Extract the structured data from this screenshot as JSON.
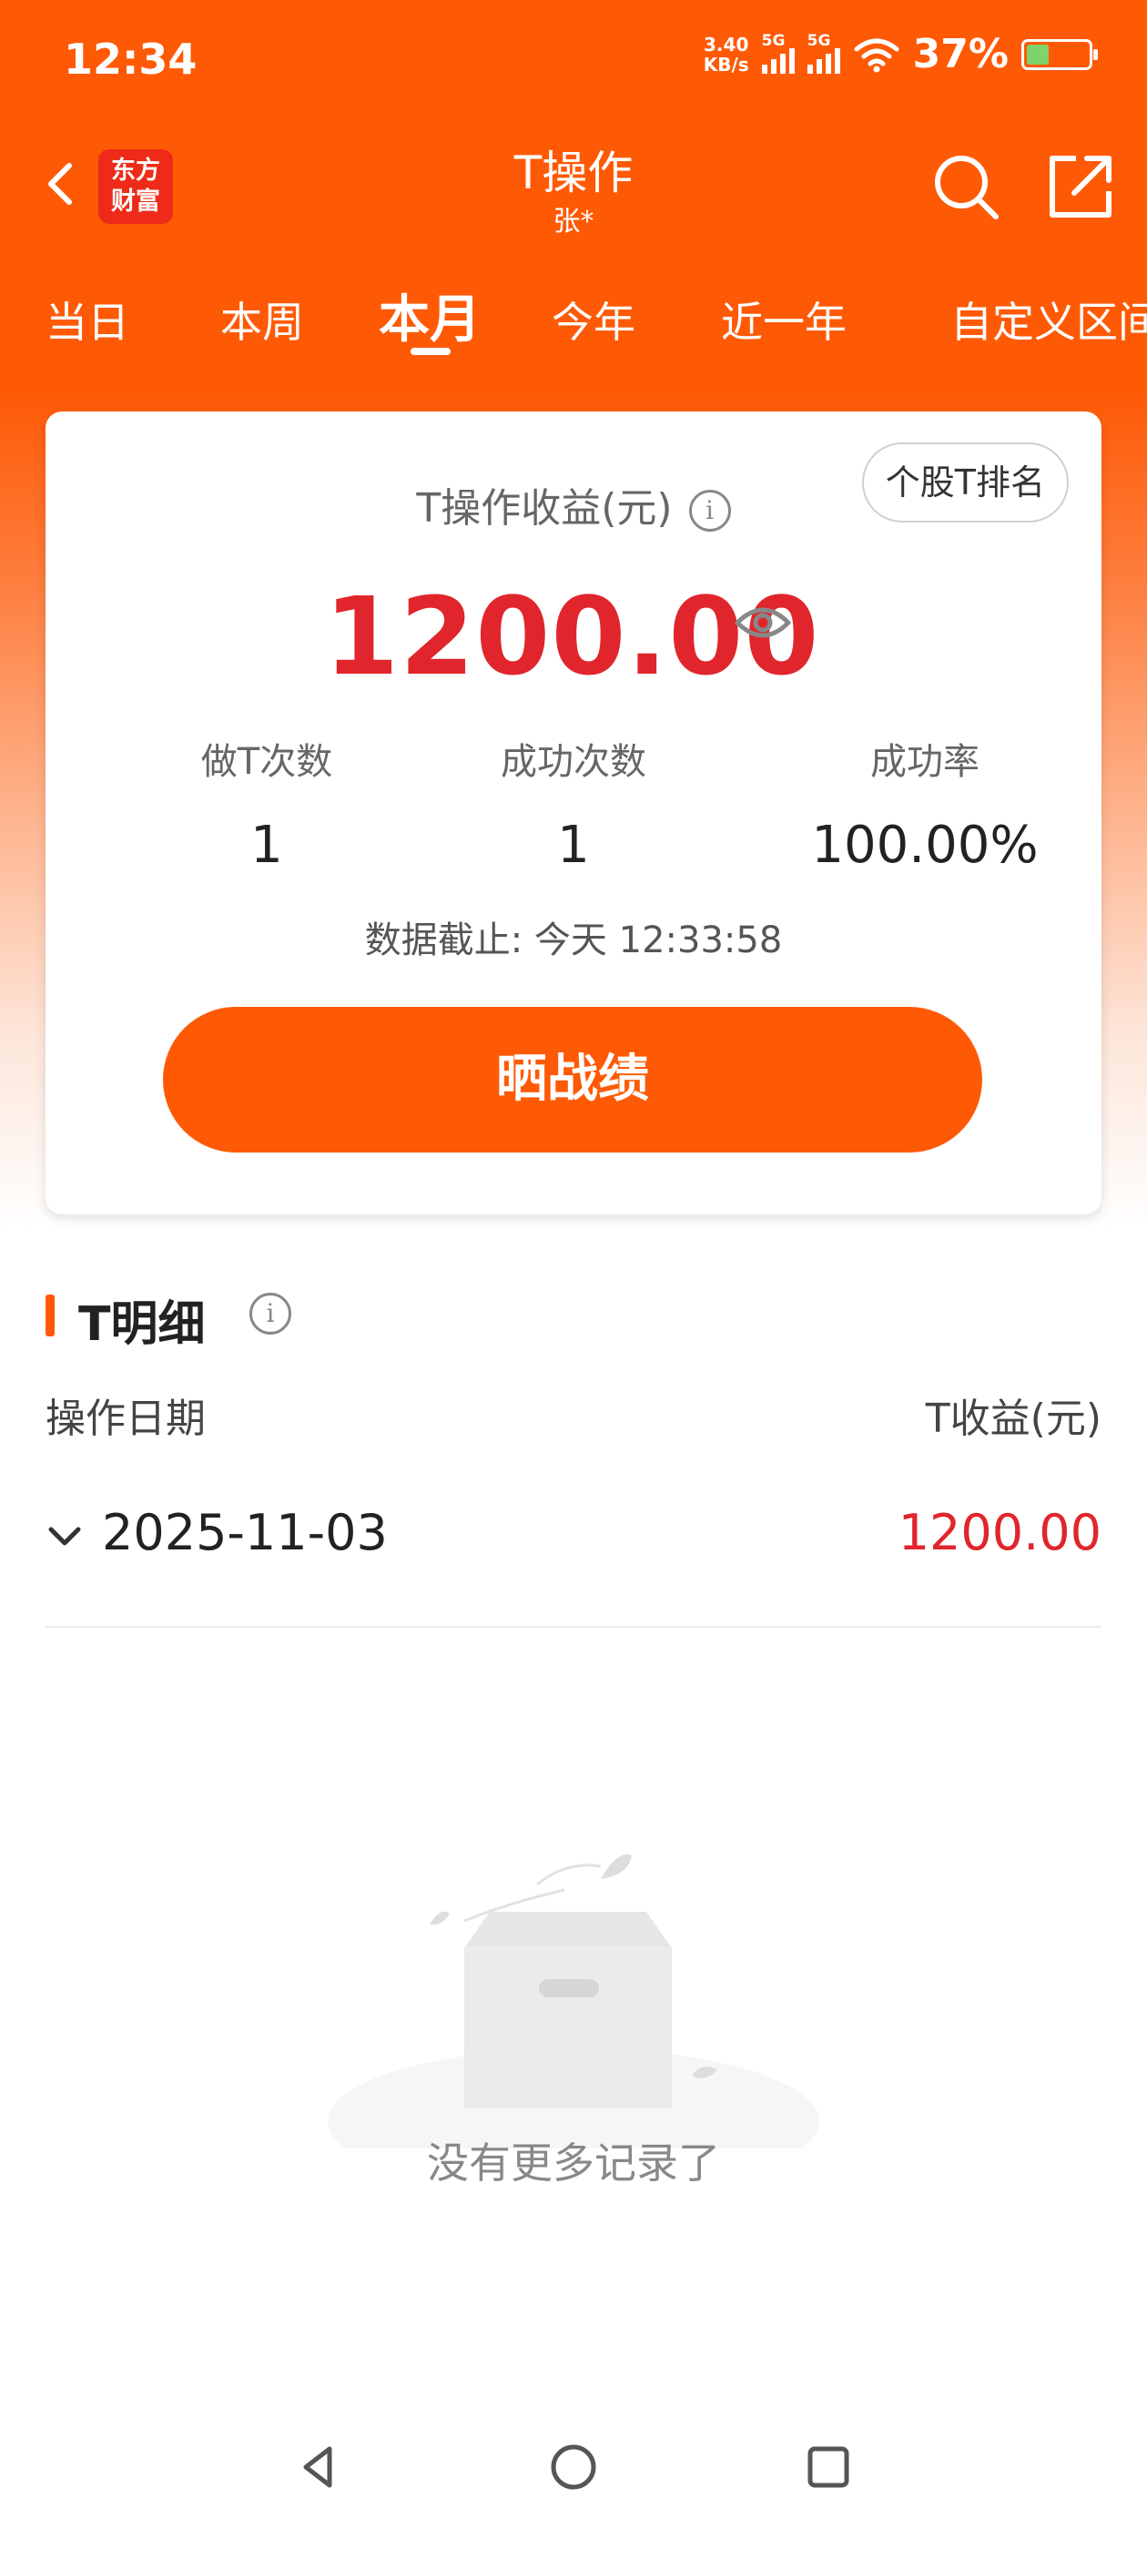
{
  "status_bar": {
    "time": "12:34",
    "net_speed_value": "3.40",
    "net_speed_unit": "KB/s",
    "sim1": "5G",
    "sim2": "5G",
    "battery_pct": "37%",
    "battery_level": 0.37
  },
  "header": {
    "logo_line1": "东方",
    "logo_line2": "财富",
    "title": "T操作",
    "subtitle": "张*"
  },
  "tabs": [
    {
      "label": "当日",
      "active": false
    },
    {
      "label": "本周",
      "active": false
    },
    {
      "label": "本月",
      "active": true
    },
    {
      "label": "今年",
      "active": false
    },
    {
      "label": "近一年",
      "active": false
    },
    {
      "label": "自定义区间",
      "active": false
    }
  ],
  "summary": {
    "rank_button": "个股T排名",
    "label": "T操作收益(元)",
    "info_glyph": "i",
    "amount": "1200.00",
    "stats": [
      {
        "label": "做T次数",
        "value": "1"
      },
      {
        "label": "成功次数",
        "value": "1"
      },
      {
        "label": "成功率",
        "value": "100.00%"
      }
    ],
    "cutoff": "数据截止: 今天 12:33:58",
    "share_button": "晒战绩"
  },
  "detail": {
    "title": "T明细",
    "col_date": "操作日期",
    "col_profit": "T收益(元)",
    "rows": [
      {
        "date": "2025-11-03",
        "profit": "1200.00"
      }
    ],
    "empty_text": "没有更多记录了"
  },
  "colors": {
    "brand": "#fe5a06",
    "profit_red": "#e0262c"
  }
}
